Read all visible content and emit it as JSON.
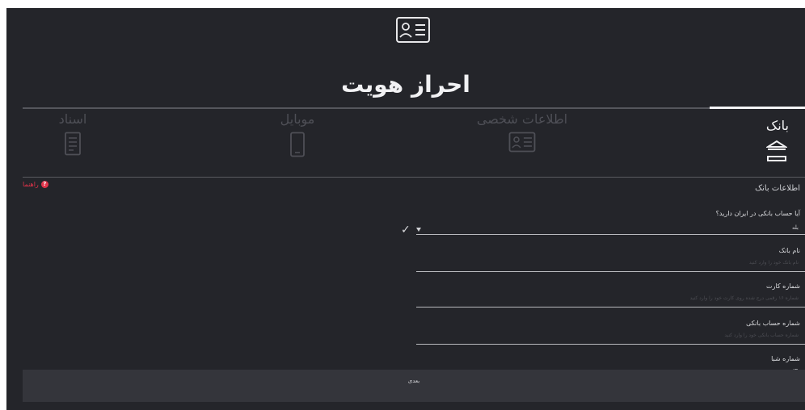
{
  "header": {
    "title": "احراز هویت",
    "icon": "id-card-icon"
  },
  "tabs": [
    {
      "label": "بانک",
      "icon": "bank-icon",
      "active": true
    },
    {
      "label": "اطلاعات شخصی",
      "icon": "id-card-icon",
      "active": false
    },
    {
      "label": "موبایل",
      "icon": "mobile-icon",
      "active": false
    },
    {
      "label": "اسناد",
      "icon": "document-icon",
      "active": false
    }
  ],
  "section": {
    "title": "اطلاعات بانک",
    "help_label": "راهنما"
  },
  "form": {
    "has_account": {
      "label": "آیا حساب بانکی در ایران دارید؟",
      "value": "بله"
    },
    "bank_name": {
      "label": "نام بانک",
      "placeholder": "نام بانک خود را وارد کنید"
    },
    "card_number": {
      "label": "شماره کارت",
      "placeholder": "شماره ۱۶ رقمی درج شده روی کارت خود را وارد کنید"
    },
    "account_number": {
      "label": "شماره حساب بانکی",
      "placeholder": "شماره حساب بانکی خود را وارد کنید"
    },
    "sheba": {
      "label": "شماره شبا",
      "value": "IR"
    }
  },
  "footer": {
    "next_label": "بعدی"
  },
  "colors": {
    "background": "#24252a",
    "accent_red": "#e0344a",
    "inactive_text": "#4e4f56"
  }
}
